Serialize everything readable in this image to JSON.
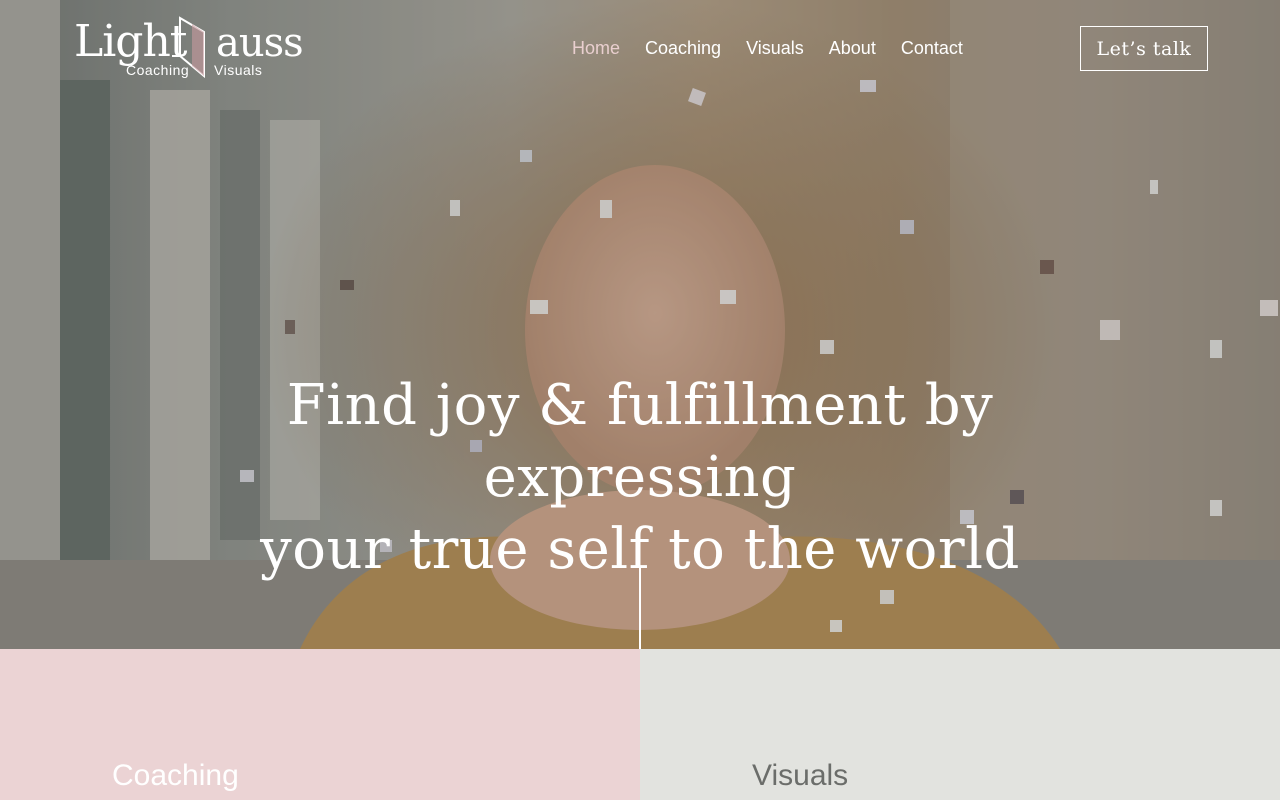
{
  "brand": {
    "word_1": "Light",
    "word_2": "auss",
    "sub_1": "Coaching",
    "sub_2": "Visuals"
  },
  "nav": {
    "items": [
      {
        "label": "Home",
        "active": true
      },
      {
        "label": "Coaching"
      },
      {
        "label": "Visuals"
      },
      {
        "label": "About"
      },
      {
        "label": "Contact"
      }
    ],
    "cta": "Let’s talk"
  },
  "hero": {
    "headline_line_1": "Find joy & fulfillment by expressing",
    "headline_line_2": "your true self to the world"
  },
  "sections": {
    "coaching_title": "Coaching",
    "visuals_title": "Visuals"
  },
  "colors": {
    "accent_pink": "#ebd3d4",
    "nav_active": "#e9cfcf",
    "neutral_panel": "#e2e3df"
  }
}
